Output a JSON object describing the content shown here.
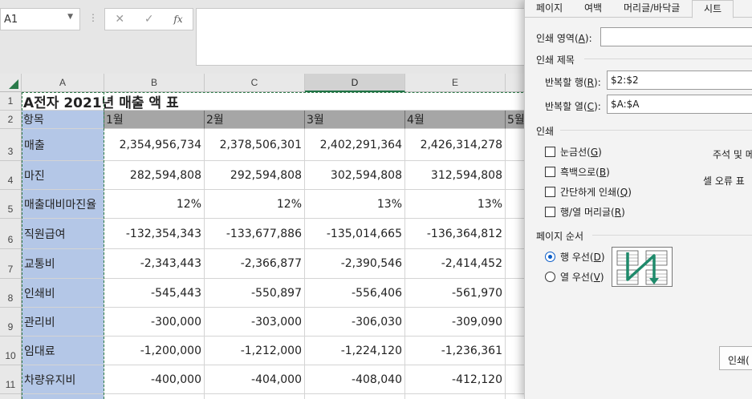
{
  "formula_bar": {
    "name_box": "A1",
    "dots": "⋮",
    "cancel_glyph": "✕",
    "enter_glyph": "✓",
    "fx_glyph": "fx",
    "formula": ""
  },
  "sheet": {
    "columns": [
      "A",
      "B",
      "C",
      "D",
      "E"
    ],
    "rows": [
      "1",
      "2",
      "3",
      "4",
      "5",
      "6",
      "7",
      "8",
      "9",
      "10",
      "11",
      ""
    ],
    "title": "A전자 2021년 매출 액 표",
    "header": [
      "항목",
      "1월",
      "2월",
      "3월",
      "4월",
      "5월"
    ],
    "data": [
      [
        "매출",
        "2,354,956,734",
        "2,378,506,301",
        "2,402,291,364",
        "2,426,314,278"
      ],
      [
        "마진",
        "282,594,808",
        "292,594,808",
        "302,594,808",
        "312,594,808"
      ],
      [
        "매출대비마진율",
        "12%",
        "12%",
        "13%",
        "13%"
      ],
      [
        "직원급여",
        "-132,354,343",
        "-133,677,886",
        "-135,014,665",
        "-136,364,812"
      ],
      [
        "교통비",
        "-2,343,443",
        "-2,366,877",
        "-2,390,546",
        "-2,414,452"
      ],
      [
        "인쇄비",
        "-545,443",
        "-550,897",
        "-556,406",
        "-561,970"
      ],
      [
        "관리비",
        "-300,000",
        "-303,000",
        "-306,030",
        "-309,090"
      ],
      [
        "임대료",
        "-1,200,000",
        "-1,212,000",
        "-1,224,120",
        "-1,236,361"
      ],
      [
        "차량유지비",
        "-400,000",
        "-404,000",
        "-408,040",
        "-412,120"
      ]
    ]
  },
  "dialog": {
    "tabs": [
      "페이지",
      "여백",
      "머리글/바닥글",
      "시트"
    ],
    "print_area_label": "인쇄 영역(A):",
    "print_area_label_pre": "인쇄 영역(",
    "print_area_key": "A",
    "print_area_value": "",
    "print_titles_label": "인쇄 제목",
    "repeat_rows_pre": "반복할 행(",
    "repeat_rows_key": "R",
    "repeat_rows_value": "$2:$2",
    "repeat_cols_pre": "반복할 열(",
    "repeat_cols_key": "C",
    "repeat_cols_value": "$A:$A",
    "print_label": "인쇄",
    "options": [
      {
        "pre": "눈금선(",
        "key": "G",
        "checked": false
      },
      {
        "pre": "흑백으로(",
        "key": "B",
        "checked": false
      },
      {
        "pre": "간단하게 인쇄(",
        "key": "Q",
        "checked": false
      },
      {
        "pre": "행/열 머리글(",
        "key": "R",
        "checked": false
      }
    ],
    "comments_label": "주석 및 메",
    "errors_label": "셀 오류 표",
    "page_order_label": "페이지 순서",
    "order_options": [
      {
        "pre": "행 우선(",
        "key": "D",
        "selected": true
      },
      {
        "pre": "열 우선(",
        "key": "V",
        "selected": false
      }
    ],
    "print_button": "인쇄(",
    "accent_color": "#0a5cc7",
    "selection_color": "#b4c7e7",
    "header_fill": "#a6a6a6",
    "excel_green": "#217346"
  }
}
